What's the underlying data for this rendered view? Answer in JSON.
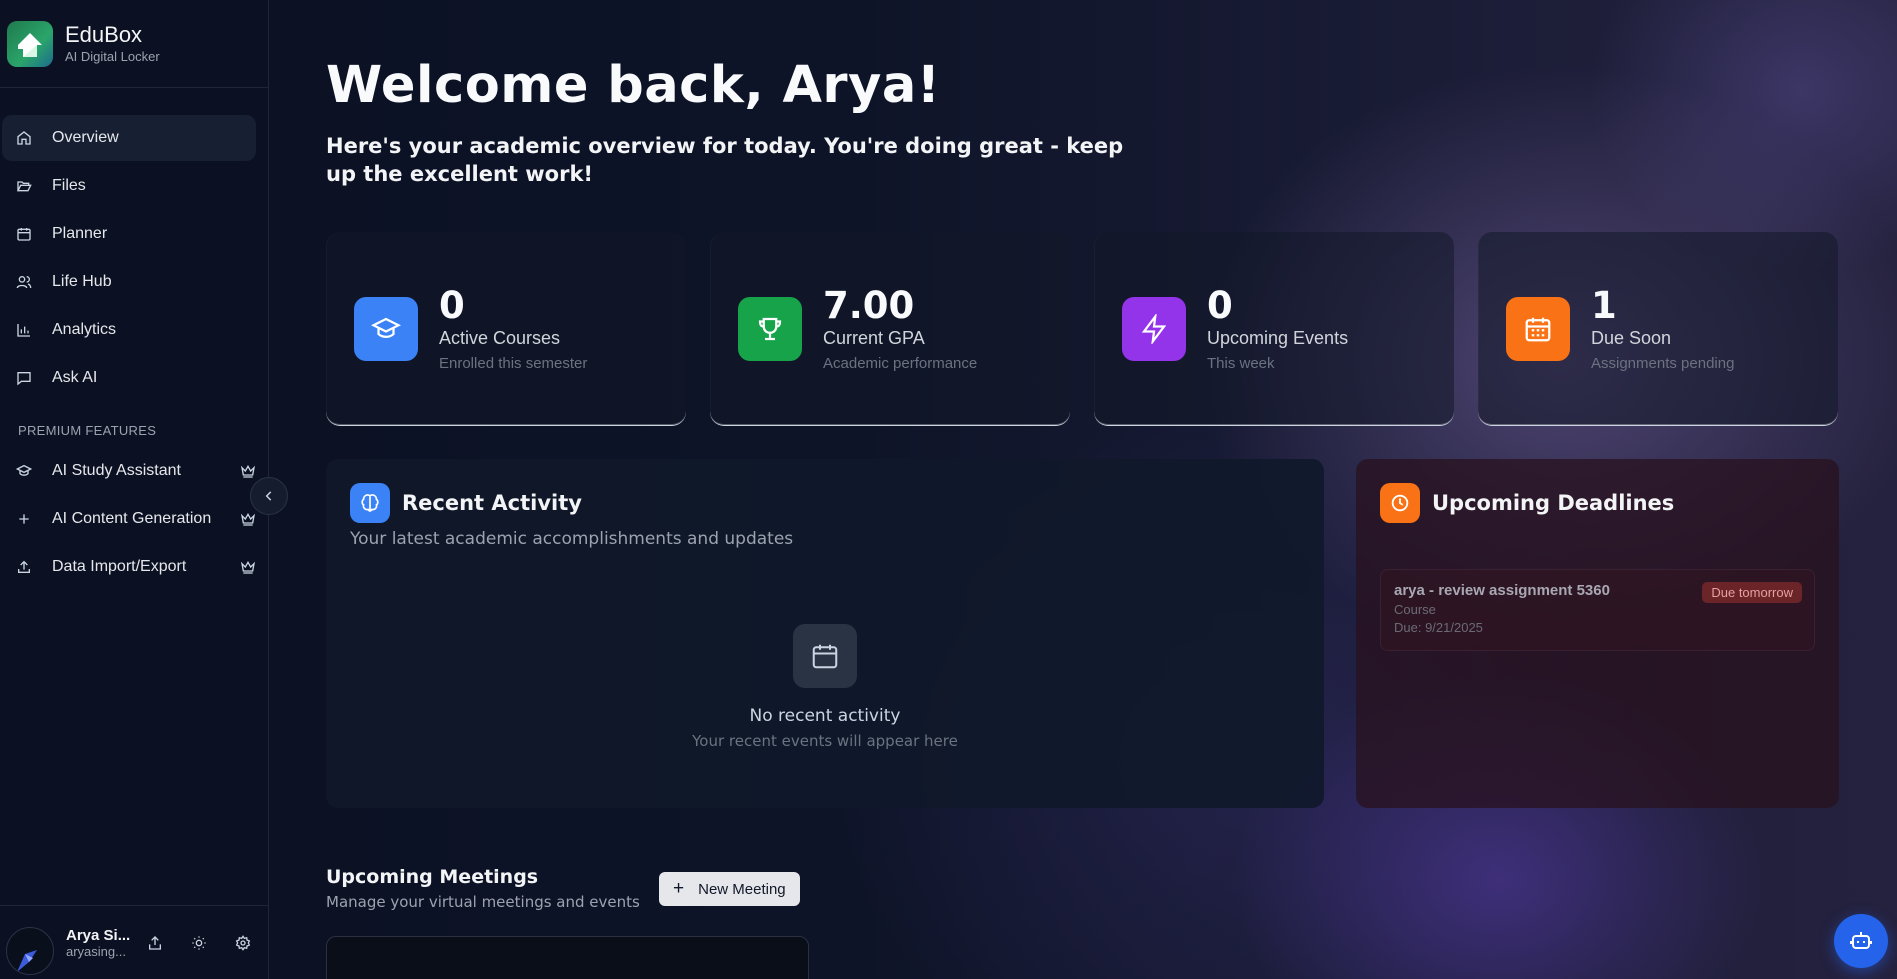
{
  "brand": {
    "name": "EduBox",
    "tagline": "AI Digital Locker"
  },
  "sidebar": {
    "items": [
      {
        "label": "Overview",
        "icon": "home-icon",
        "active": true
      },
      {
        "label": "Files",
        "icon": "folder-open-icon"
      },
      {
        "label": "Planner",
        "icon": "calendar-icon"
      },
      {
        "label": "Life Hub",
        "icon": "users-icon"
      },
      {
        "label": "Analytics",
        "icon": "bar-chart-icon"
      },
      {
        "label": "Ask AI",
        "icon": "message-square-icon"
      }
    ],
    "premium_title": "PREMIUM FEATURES",
    "premium_items": [
      {
        "label": "AI Study Assistant",
        "icon": "graduation-cap-icon",
        "badge": "crown-icon"
      },
      {
        "label": "AI Content Generation",
        "icon": "plus-icon",
        "badge": "crown-icon"
      },
      {
        "label": "Data Import/Export",
        "icon": "upload-icon",
        "badge": "crown-icon"
      }
    ]
  },
  "user": {
    "name": "Arya Si...",
    "email": "aryasing..."
  },
  "main": {
    "welcome": "Welcome back, Arya!",
    "subtitle": "Here's your academic overview for today. You're doing great - keep up the excellent work!",
    "stats": [
      {
        "value": "0",
        "label": "Active Courses",
        "sub": "Enrolled this semester",
        "icon": "graduation-cap-icon",
        "color": "#3b82f6"
      },
      {
        "value": "7.00",
        "label": "Current GPA",
        "sub": "Academic performance",
        "icon": "trophy-icon",
        "color": "#16a34a"
      },
      {
        "value": "0",
        "label": "Upcoming Events",
        "sub": "This week",
        "icon": "lightning-icon",
        "color": "#9333ea"
      },
      {
        "value": "1",
        "label": "Due Soon",
        "sub": "Assignments pending",
        "icon": "calendar-icon",
        "color": "#f97316"
      }
    ],
    "recent_activity": {
      "title": "Recent Activity",
      "subtitle": "Your latest academic accomplishments and updates",
      "empty_title": "No recent activity",
      "empty_sub": "Your recent events will appear here"
    },
    "deadlines": {
      "title": "Upcoming Deadlines",
      "items": [
        {
          "title": "arya - review assignment 5360",
          "course": "Course",
          "due": "Due: 9/21/2025",
          "badge": "Due tomorrow"
        }
      ]
    },
    "meetings": {
      "title": "Upcoming Meetings",
      "subtitle": "Manage your virtual meetings and events",
      "new_button": "New Meeting"
    }
  },
  "colors": {
    "accent_blue": "#2563eb",
    "sidebar_bg": "#0b1122",
    "badge_red": "#6b2428"
  }
}
